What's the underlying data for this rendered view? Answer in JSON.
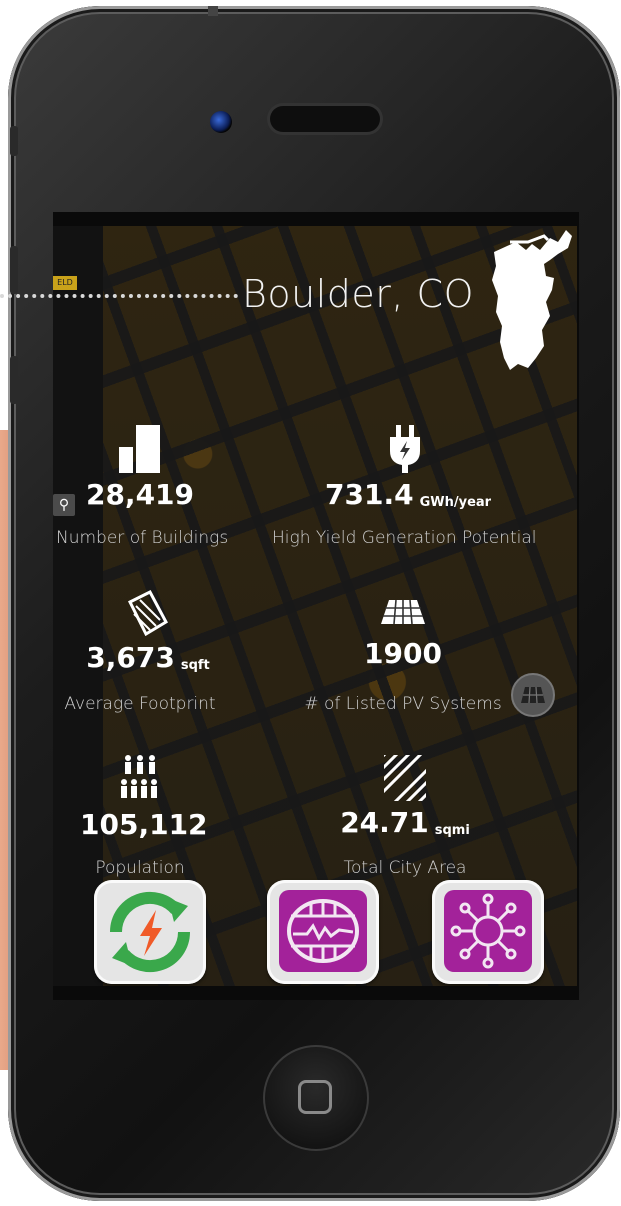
{
  "header": {
    "city": "Boulder, CO",
    "map_badge": "ELD"
  },
  "stats": [
    {
      "value": "28,419",
      "unit": "",
      "label": "Number of Buildings"
    },
    {
      "value": "731.4",
      "unit": "GWh/year",
      "label": "High Yield Generation Potential"
    },
    {
      "value": "3,673",
      "unit": "sqft",
      "label": "Average Footprint"
    },
    {
      "value": "1900",
      "unit": "",
      "label": "# of Listed PV Systems"
    },
    {
      "value": "105,112",
      "unit": "",
      "label": "Population"
    },
    {
      "value": "24.71",
      "unit": "sqmi",
      "label": "Total City Area"
    }
  ],
  "icons": {
    "buildings": "buildings-icon",
    "plug": "plug-icon",
    "footprint": "footprint-icon",
    "solar_panel": "solar-panel-icon",
    "population": "people-icon",
    "area": "hatched-area-icon",
    "search": "search-icon"
  },
  "apps": [
    {
      "name": "energy-refresh-app",
      "color": "#3aa84b"
    },
    {
      "name": "meter-app",
      "color": "#a3229a"
    },
    {
      "name": "network-app",
      "color": "#a3229a"
    }
  ],
  "colors": {
    "accent_green": "#3aa84b",
    "accent_magenta": "#a3229a",
    "bolt": "#f05a28"
  }
}
